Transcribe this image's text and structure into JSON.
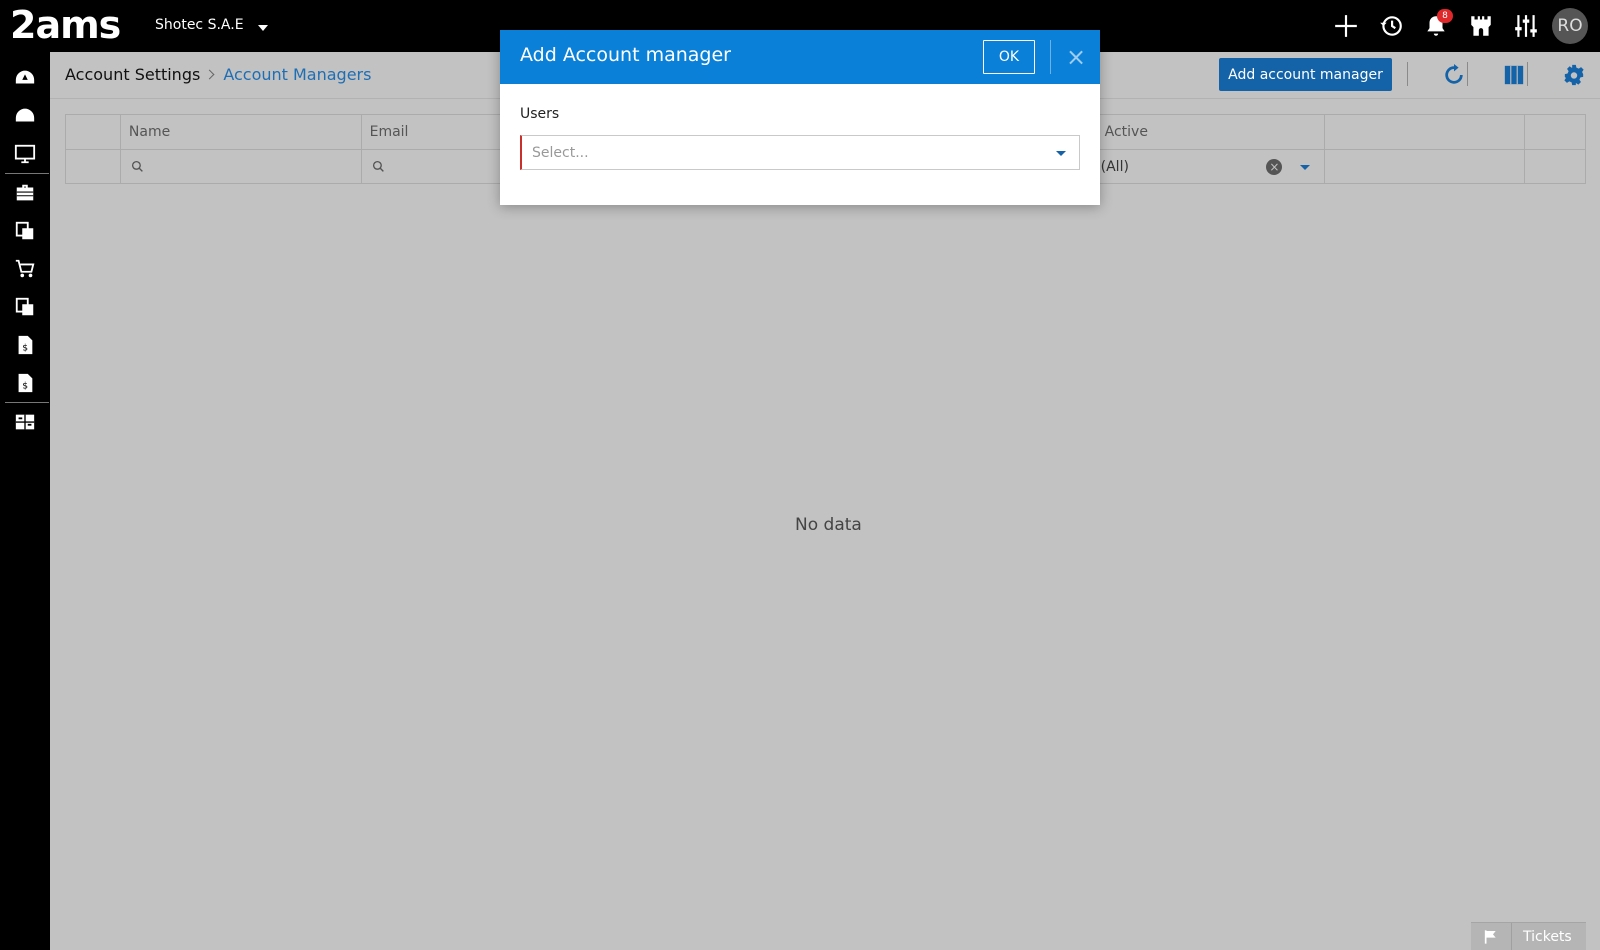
{
  "app": {
    "logo_text": "2ams",
    "company_name": "Shotec S.A.E",
    "notifications_count": "8",
    "user_initials": "RO"
  },
  "top_icons": [
    "plus-icon",
    "history-icon",
    "bell-icon",
    "castle-icon",
    "sliders-icon"
  ],
  "sidebar": {
    "items": [
      "dashboard-icon",
      "dashboard-alt-icon",
      "monitor-icon",
      "briefcase-icon",
      "documents-icon",
      "cart-icon",
      "documents-alt-icon",
      "invoice-icon",
      "invoice-alt-icon",
      "reports-icon"
    ]
  },
  "breadcrumb": {
    "root": "Account Settings",
    "current": "Account Managers"
  },
  "toolbar": {
    "add_label": "Add account manager"
  },
  "grid": {
    "columns": [
      "Name",
      "Email",
      "Active"
    ],
    "active_filter_value": "(All)",
    "empty_text": "No data"
  },
  "tickets": {
    "label": "Tickets"
  },
  "modal": {
    "title": "Add Account manager",
    "ok_label": "OK",
    "close_label": "×",
    "field_label": "Users",
    "placeholder": "Select..."
  },
  "colors": {
    "modal_header": "#0a80d8",
    "primary_button": "#1463a8",
    "breadcrumb_link": "#1e6eb5",
    "required_marker": "#c9302c",
    "badge": "#e0272a"
  }
}
